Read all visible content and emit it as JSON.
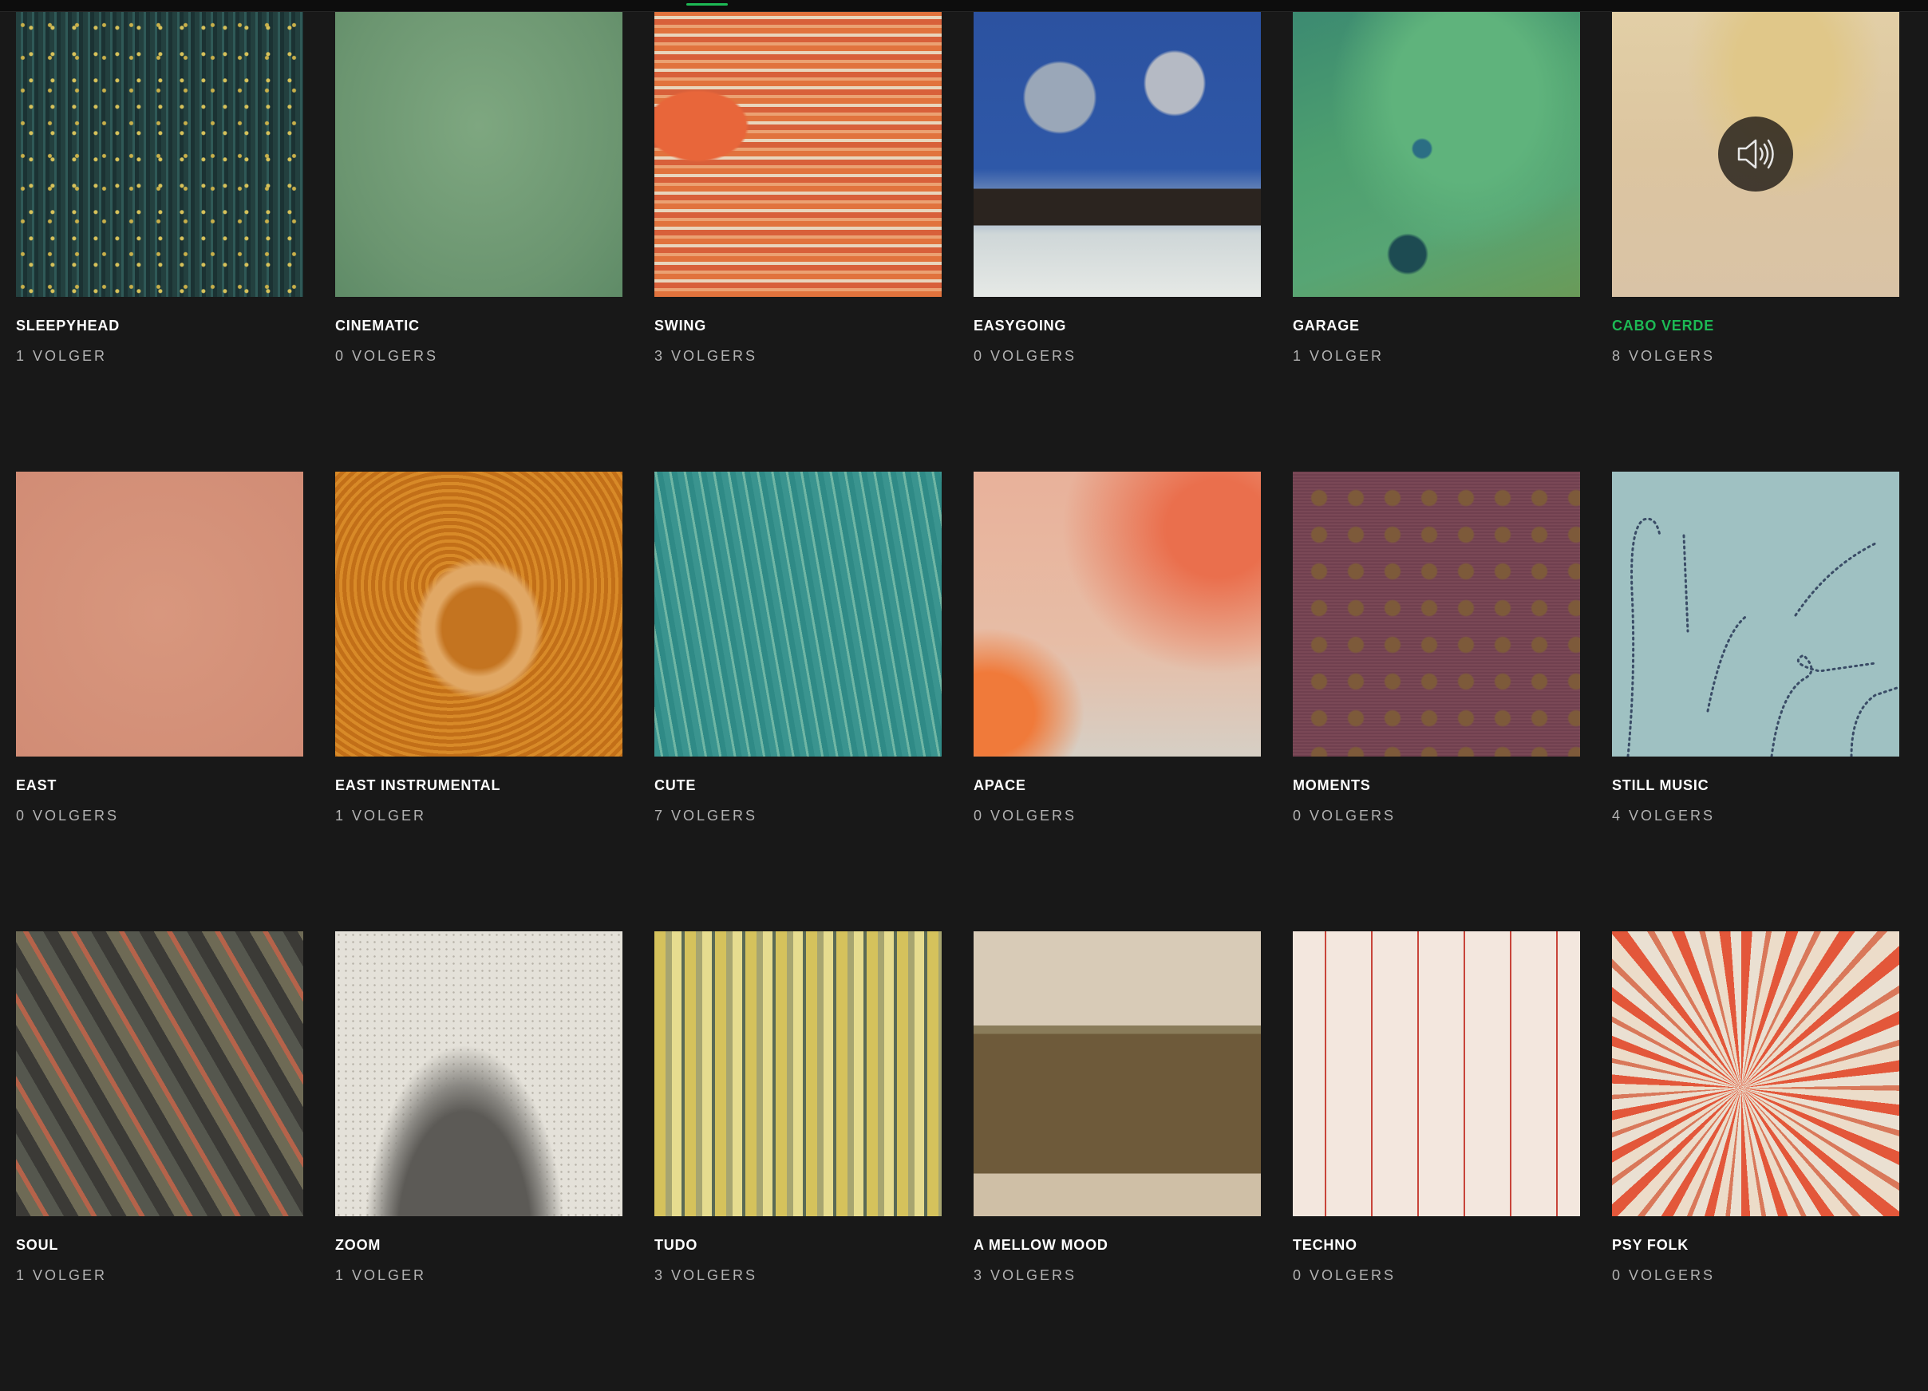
{
  "accent": "#1db954",
  "playlists": [
    {
      "title": "SLEEPYHEAD",
      "followers": "1 VOLGER"
    },
    {
      "title": "CINEMATIC",
      "followers": "0 VOLGERS"
    },
    {
      "title": "SWING",
      "followers": "3 VOLGERS"
    },
    {
      "title": "EASYGOING",
      "followers": "0 VOLGERS"
    },
    {
      "title": "GARAGE",
      "followers": "1 VOLGER"
    },
    {
      "title": "CABO VERDE",
      "followers": "8 VOLGERS",
      "active": true,
      "overlay_icon": "speaker-icon"
    },
    {
      "title": "EAST",
      "followers": "0 VOLGERS"
    },
    {
      "title": "EAST INSTRUMENTAL",
      "followers": "1 VOLGER"
    },
    {
      "title": "CUTE",
      "followers": "7 VOLGERS"
    },
    {
      "title": "APACE",
      "followers": "0 VOLGERS"
    },
    {
      "title": "MOMENTS",
      "followers": "0 VOLGERS"
    },
    {
      "title": "STILL MUSIC",
      "followers": "4 VOLGERS"
    },
    {
      "title": "SOUL",
      "followers": "1 VOLGER"
    },
    {
      "title": "ZOOM",
      "followers": "1 VOLGER"
    },
    {
      "title": "TUDO",
      "followers": "3 VOLGERS"
    },
    {
      "title": "A MELLOW MOOD",
      "followers": "3 VOLGERS"
    },
    {
      "title": "TECHNO",
      "followers": "0 VOLGERS"
    },
    {
      "title": "PSY FOLK",
      "followers": "0 VOLGERS"
    }
  ]
}
